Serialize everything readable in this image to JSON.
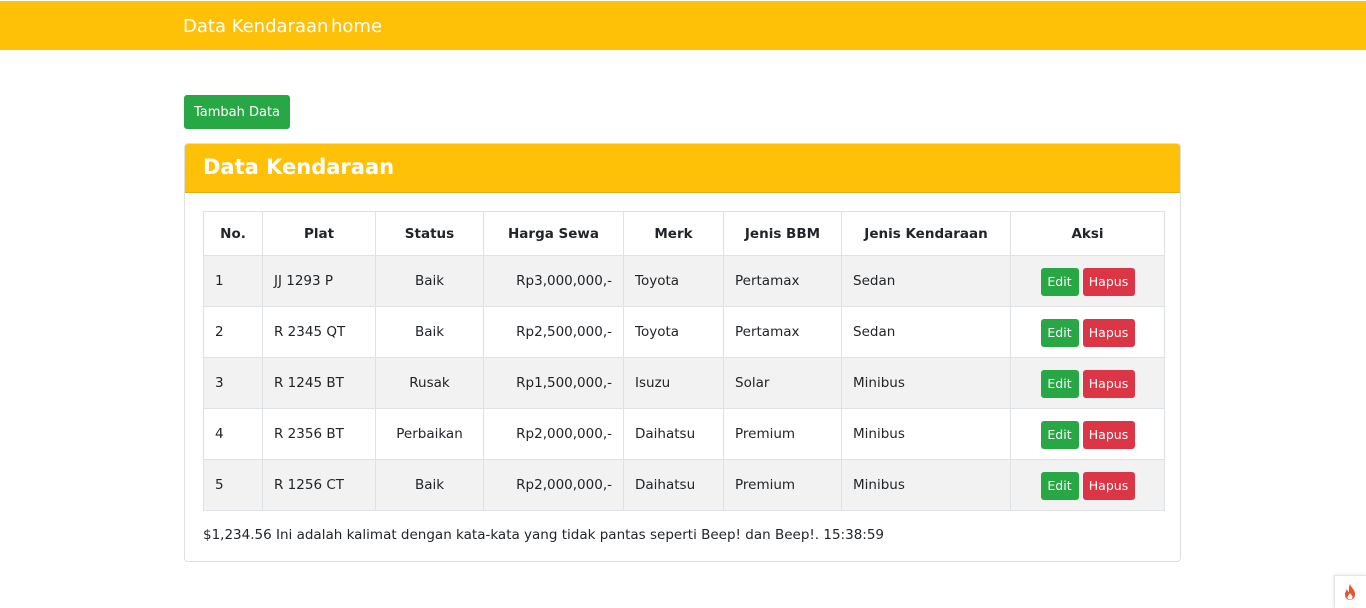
{
  "nav": {
    "brand": "Data Kendaraan",
    "home": "home"
  },
  "actions": {
    "add_label": "Tambah Data"
  },
  "card": {
    "title": "Data Kendaraan"
  },
  "table": {
    "headers": [
      "No.",
      "Plat",
      "Status",
      "Harga Sewa",
      "Merk",
      "Jenis BBM",
      "Jenis Kendaraan",
      "Aksi"
    ],
    "rows": [
      {
        "no": "1",
        "plat": "JJ 1293 P",
        "status": "Baik",
        "harga": "Rp3,000,000,-",
        "merk": "Toyota",
        "bbm": "Pertamax",
        "jenis": "Sedan"
      },
      {
        "no": "2",
        "plat": "R 2345 QT",
        "status": "Baik",
        "harga": "Rp2,500,000,-",
        "merk": "Toyota",
        "bbm": "Pertamax",
        "jenis": "Sedan"
      },
      {
        "no": "3",
        "plat": "R 1245 BT",
        "status": "Rusak",
        "harga": "Rp1,500,000,-",
        "merk": "Isuzu",
        "bbm": "Solar",
        "jenis": "Minibus"
      },
      {
        "no": "4",
        "plat": "R 2356 BT",
        "status": "Perbaikan",
        "harga": "Rp2,000,000,-",
        "merk": "Daihatsu",
        "bbm": "Premium",
        "jenis": "Minibus"
      },
      {
        "no": "5",
        "plat": "R 1256 CT",
        "status": "Baik",
        "harga": "Rp2,000,000,-",
        "merk": "Daihatsu",
        "bbm": "Premium",
        "jenis": "Minibus"
      }
    ],
    "edit_label": "Edit",
    "delete_label": "Hapus"
  },
  "footer": {
    "text": "$1,234.56 Ini adalah kalimat dengan kata-kata yang tidak pantas seperti Beep! dan Beep!. 15:38:59"
  },
  "colors": {
    "primary": "#ffc107",
    "success": "#28a745",
    "danger": "#dc3545"
  },
  "icons": {
    "corner": "flame-icon"
  }
}
